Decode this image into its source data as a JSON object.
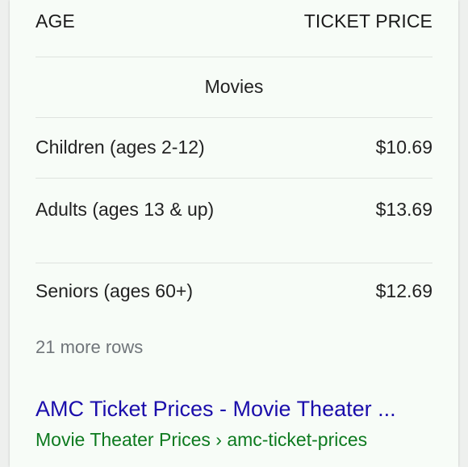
{
  "table": {
    "headers": {
      "age": "AGE",
      "price": "TICKET PRICE"
    },
    "section": "Movies",
    "rows": [
      {
        "label": "Children (ages 2-12)",
        "price": "$10.69"
      },
      {
        "label": "Adults (ages 13 & up)",
        "price": "$13.69"
      },
      {
        "label": "Seniors (ages 60+)",
        "price": "$12.69"
      }
    ],
    "more_rows": "21 more rows"
  },
  "result": {
    "title": "AMC Ticket Prices - Movie Theater ...",
    "breadcrumb": "Movie Theater Prices › amc-ticket-prices"
  },
  "colors": {
    "link": "#1a0dab",
    "url": "#0d7a1f",
    "muted": "#70757a"
  }
}
